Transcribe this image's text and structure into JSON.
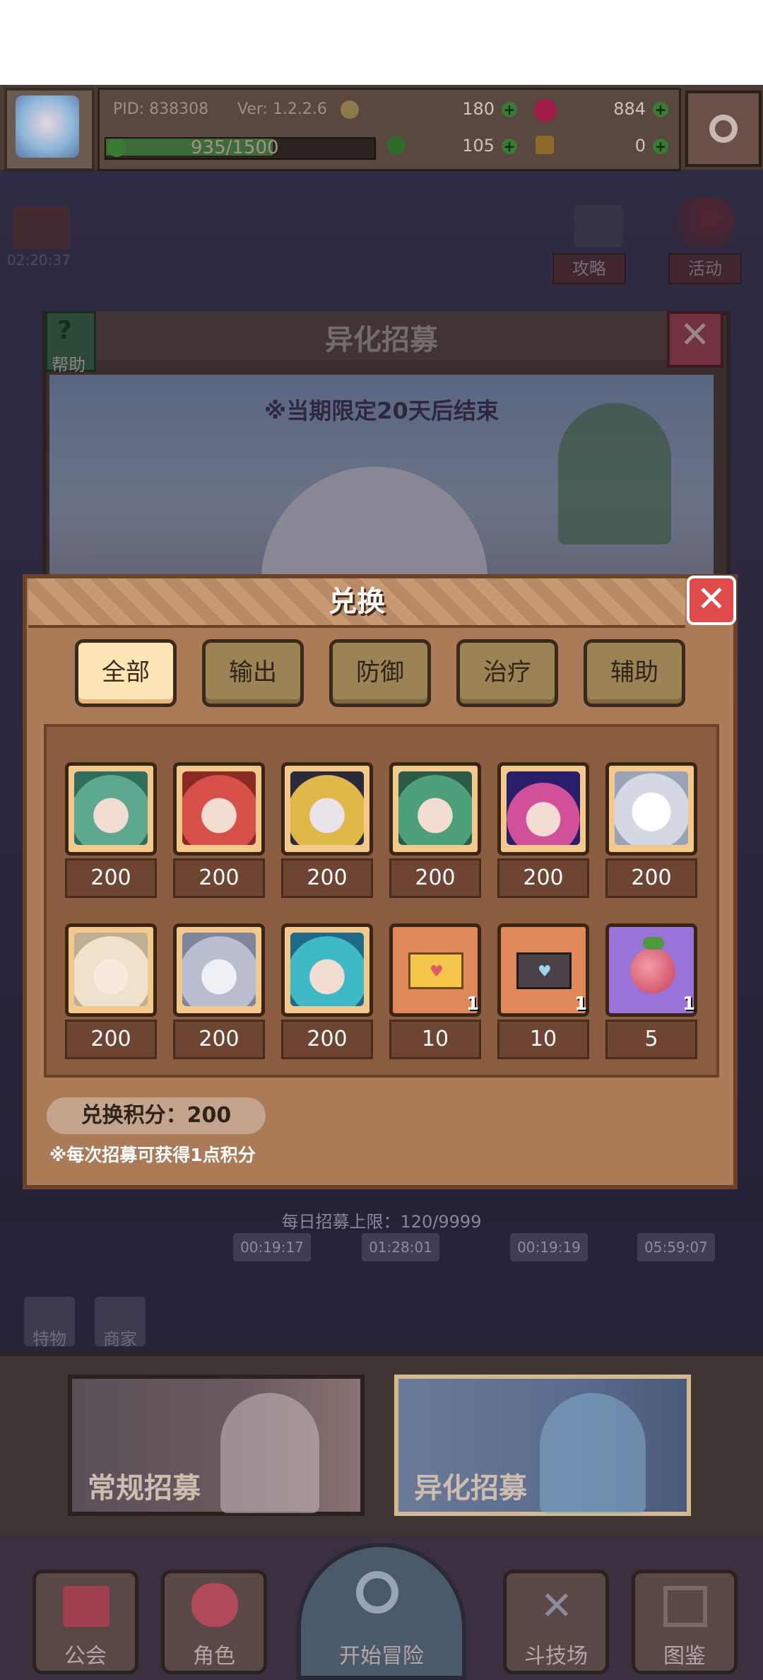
{
  "header": {
    "pid": "PID: 838308",
    "version": "Ver: 1.2.2.6",
    "xp": "935/1500",
    "currencies": [
      {
        "name": "clover",
        "value": "180",
        "color": "#3b7a34"
      },
      {
        "name": "gem",
        "value": "884",
        "color": "#b01e4a"
      },
      {
        "name": "leaf",
        "value": "105",
        "color": "#3b7a34"
      },
      {
        "name": "key",
        "value": "0",
        "color": "#8c6a2a"
      }
    ]
  },
  "side": {
    "timer": "02:20:37",
    "guide": "攻略",
    "event": "活动"
  },
  "recruit": {
    "title": "异化招募",
    "help": "帮助",
    "notice": "※当期限定20天后结束"
  },
  "dialog": {
    "title": "兑换",
    "tabs": [
      {
        "label": "全部",
        "active": true
      },
      {
        "label": "输出",
        "active": false
      },
      {
        "label": "防御",
        "active": false
      },
      {
        "label": "治疗",
        "active": false
      },
      {
        "label": "辅助",
        "active": false
      }
    ],
    "items": [
      {
        "icon": "green-hair-hero-portrait",
        "price": "200"
      },
      {
        "icon": "red-hair-hero-portrait",
        "price": "200"
      },
      {
        "icon": "blonde-gold-hero-portrait",
        "price": "200"
      },
      {
        "icon": "green-hair-miko-portrait",
        "price": "200"
      },
      {
        "icon": "purple-starry-hero-portrait",
        "price": "200"
      },
      {
        "icon": "white-spirit-hero-portrait",
        "price": "200"
      },
      {
        "icon": "cream-hair-hero-portrait",
        "price": "200"
      },
      {
        "icon": "silver-hair-hero-portrait",
        "price": "200"
      },
      {
        "icon": "teal-hair-hero-portrait",
        "price": "200"
      },
      {
        "icon": "gold-letter-icon",
        "price": "10",
        "qty": "1"
      },
      {
        "icon": "dark-letter-icon",
        "price": "10",
        "qty": "1"
      },
      {
        "icon": "pink-fruit-icon",
        "price": "5",
        "qty": "1"
      }
    ],
    "points": "兑换积分：200",
    "note": "※每次招募可获得1点积分"
  },
  "bottom": {
    "daily_limit": "每日招募上限：120/9999",
    "timers": [
      "00:19:17",
      "01:28:01",
      "00:19:19",
      "05:59:07"
    ],
    "side_btns": [
      "特物",
      "商家"
    ],
    "normal_recruit": "常规招募",
    "alien_recruit": "异化招募"
  },
  "nav": [
    "公会",
    "角色",
    "开始冒险",
    "斗技场",
    "图鉴"
  ]
}
